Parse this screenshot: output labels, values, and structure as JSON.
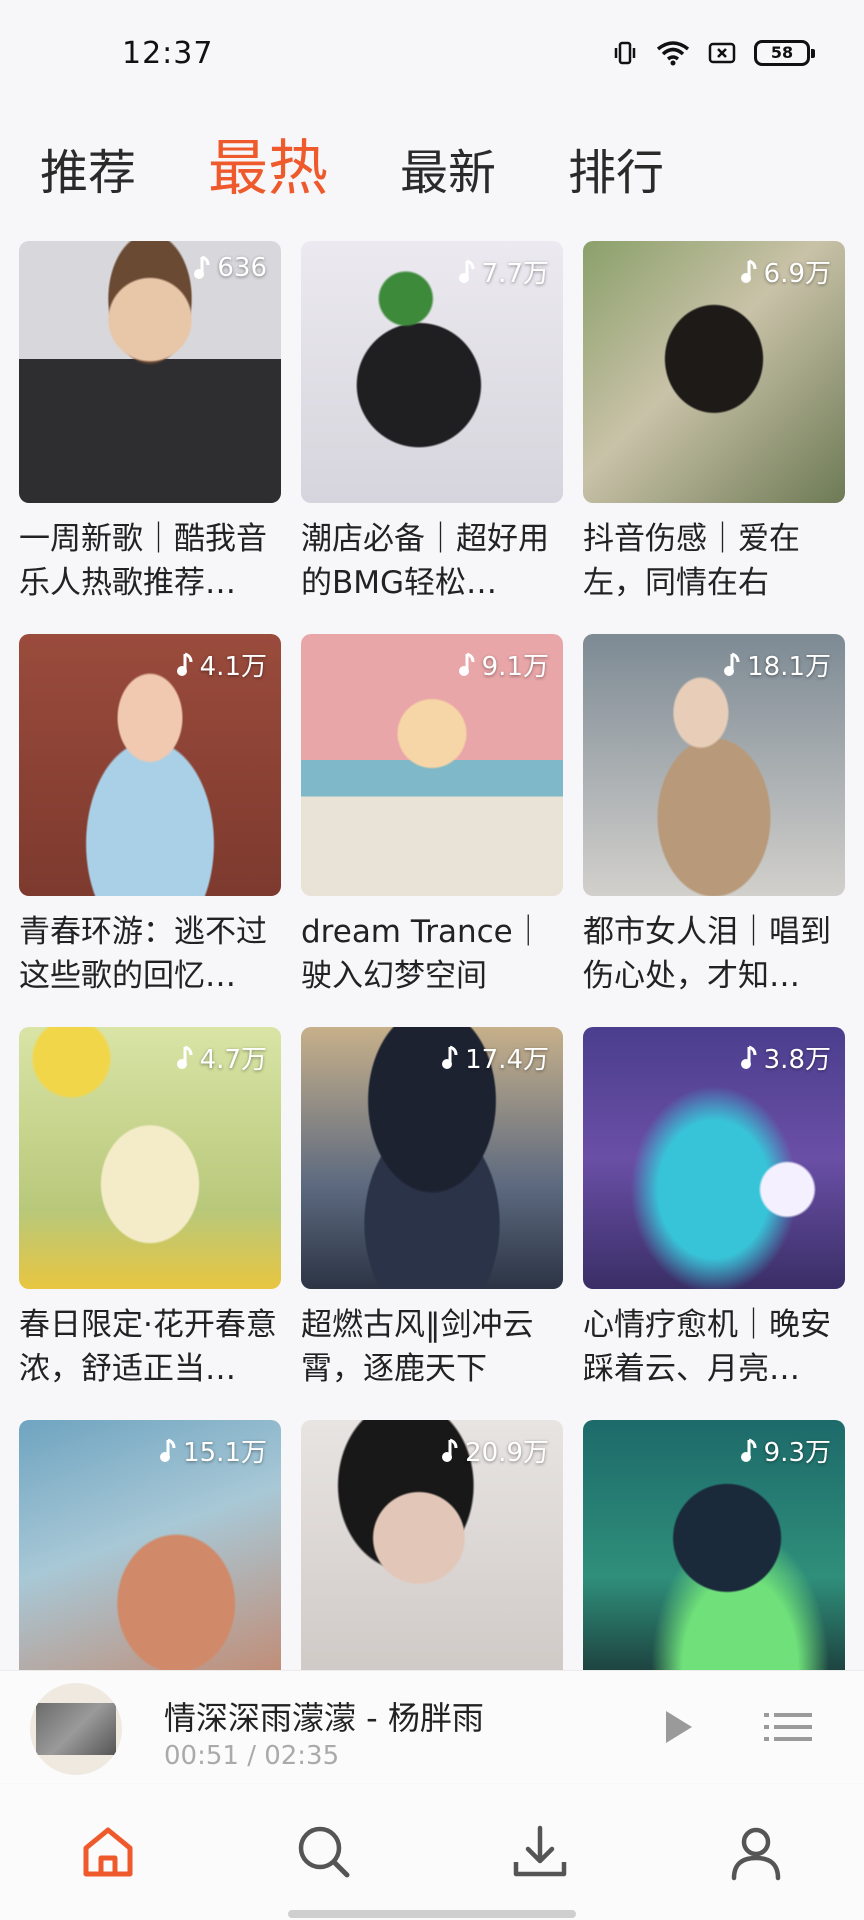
{
  "status_bar": {
    "time": "12:37",
    "battery": "58",
    "icons": [
      "vibrate-icon",
      "wifi-icon",
      "sim-off-icon",
      "battery-icon"
    ]
  },
  "tabs": [
    {
      "label": "推荐",
      "active": false
    },
    {
      "label": "最热",
      "active": true
    },
    {
      "label": "最新",
      "active": false
    },
    {
      "label": "排行",
      "active": false
    }
  ],
  "accent_color": "#ee5a2c",
  "playlists": [
    {
      "title": "一周新歌｜酷我音乐人热歌推荐…",
      "count": "636"
    },
    {
      "title": "潮店必备｜超好用的BMG轻松…",
      "count": "7.7万"
    },
    {
      "title": "抖音伤感｜爱在左，同情在右",
      "count": "6.9万"
    },
    {
      "title": "青春环游：逃不过这些歌的回忆…",
      "count": "4.1万"
    },
    {
      "title": "dream Trance｜驶入幻梦空间",
      "count": "9.1万"
    },
    {
      "title": "都市女人泪｜唱到伤心处，才知…",
      "count": "18.1万"
    },
    {
      "title": "春日限定·花开春意浓，舒适正当…",
      "count": "4.7万"
    },
    {
      "title": "超燃古风‖剑冲云霄，逐鹿天下",
      "count": "17.4万"
    },
    {
      "title": "心情疗愈机｜晚安踩着云、月亮…",
      "count": "3.8万"
    },
    {
      "title": "",
      "count": "15.1万"
    },
    {
      "title": "",
      "count": "20.9万"
    },
    {
      "title": "",
      "count": "9.3万"
    }
  ],
  "player": {
    "song": "情深深雨濛濛 - 杨胖雨",
    "time": "00:51 / 02:35"
  },
  "bottom_nav": [
    "home-icon",
    "search-icon",
    "download-icon",
    "profile-icon"
  ]
}
